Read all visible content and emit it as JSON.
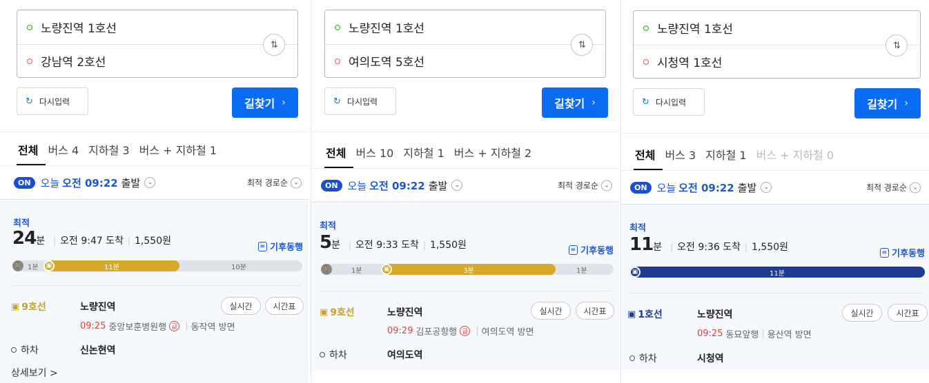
{
  "panels": [
    {
      "from": "노량진역 1호선",
      "to": "강남역 2호선",
      "swap_icon": "⇅",
      "reset_label": "다시입력",
      "reset_icon": "↻",
      "find_label": "길찾기",
      "find_chevron": "›",
      "tabs": [
        "전체",
        "버스 4",
        "지하철 3",
        "버스 + 지하철 1"
      ],
      "on_badge": "ON",
      "today": "오늘",
      "time": "오전 09:22",
      "depart": "출발",
      "sort": "최적 경로순",
      "best": "최적",
      "minutes": "24",
      "minutes_unit": "분",
      "arrival": "오전 9:47 도착",
      "fare": "1,550원",
      "climate": "기후동행",
      "segments": {
        "walk1": "1분",
        "train": "11분",
        "walk2": "10분"
      },
      "line": "9호선",
      "line_color": "#c7a12f",
      "station": "노량진역",
      "realtime": "실시간",
      "timetable": "시간표",
      "dep_time": "09:25",
      "dep_dest": "중앙보훈병원행",
      "express": "급",
      "direction": "동작역 방면",
      "alight_label": "하차",
      "alight_station": "신논현역",
      "more": "상세보기 >"
    },
    {
      "from": "노량진역 1호선",
      "to": "여의도역 5호선",
      "swap_icon": "⇅",
      "reset_label": "다시입력",
      "reset_icon": "↻",
      "find_label": "길찾기",
      "find_chevron": "›",
      "tabs": [
        "전체",
        "버스 10",
        "지하철 1",
        "버스 + 지하철 2"
      ],
      "on_badge": "ON",
      "today": "오늘",
      "time": "오전 09:22",
      "depart": "출발",
      "sort": "최적 경로순",
      "best": "최적",
      "minutes": "5",
      "minutes_unit": "분",
      "arrival": "오전 9:33 도착",
      "fare": "1,550원",
      "climate": "기후동행",
      "segments": {
        "walk1": "1분",
        "train": "3분",
        "walk2": "1분"
      },
      "line": "9호선",
      "line_color": "#c7a12f",
      "station": "노량진역",
      "realtime": "실시간",
      "timetable": "시간표",
      "dep_time": "09:29",
      "dep_dest": "김포공항행",
      "express": "급",
      "direction": "여의도역 방면",
      "alight_label": "하차",
      "alight_station": "여의도역"
    },
    {
      "from": "노량진역 1호선",
      "to": "시청역 1호선",
      "swap_icon": "⇅",
      "reset_label": "다시입력",
      "reset_icon": "↻",
      "find_label": "길찾기",
      "find_chevron": "›",
      "tabs": [
        "전체",
        "버스 3",
        "지하철 1",
        "버스 + 지하철 0"
      ],
      "on_badge": "ON",
      "today": "오늘",
      "time": "오전 09:22",
      "depart": "출발",
      "sort": "최적 경로순",
      "best": "최적",
      "minutes": "11",
      "minutes_unit": "분",
      "arrival": "오전 9:36 도착",
      "fare": "1,550원",
      "climate": "기후동행",
      "segments": {
        "train": "11분"
      },
      "line": "1호선",
      "line_color": "#1f3a93",
      "station": "노량진역",
      "realtime": "실시간",
      "timetable": "시간표",
      "dep_time": "09:25",
      "dep_dest": "동묘앞행",
      "direction": "용산역 방면",
      "alight_label": "하차",
      "alight_station": "시청역"
    }
  ],
  "icons": {
    "walk": "walk-icon",
    "train": "train-icon",
    "climate": "∞"
  },
  "colors": {
    "primary": "#0a6cf3",
    "line9": "#c7a12f",
    "line1": "#1f3a93",
    "express": "#e0413a"
  }
}
